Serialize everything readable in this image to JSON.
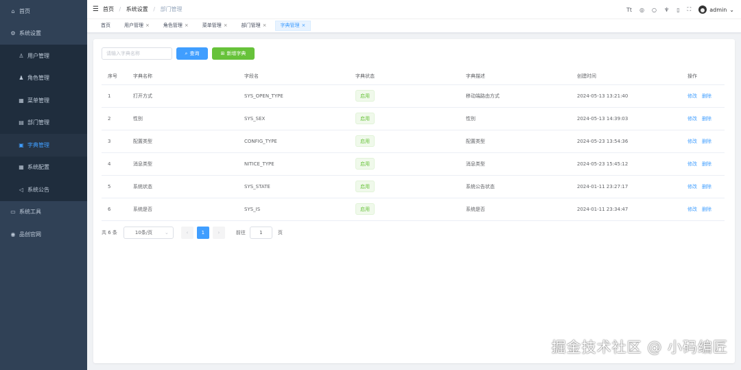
{
  "sidebar": {
    "items": [
      {
        "label": "首页",
        "icon": "home-icon",
        "glyph": "⌂",
        "level": 0,
        "active": false
      },
      {
        "label": "系统设置",
        "icon": "settings-icon",
        "glyph": "⚙",
        "level": 0,
        "active": false
      },
      {
        "label": "用户管理",
        "icon": "user-icon",
        "glyph": "♙",
        "level": 1,
        "active": false
      },
      {
        "label": "角色管理",
        "icon": "role-icon",
        "glyph": "♟",
        "level": 1,
        "active": false
      },
      {
        "label": "菜单管理",
        "icon": "menu-icon",
        "glyph": "▦",
        "level": 1,
        "active": false
      },
      {
        "label": "部门管理",
        "icon": "department-icon",
        "glyph": "▤",
        "level": 1,
        "active": false
      },
      {
        "label": "字典管理",
        "icon": "dictionary-icon",
        "glyph": "▣",
        "level": 1,
        "active": true
      },
      {
        "label": "系统配置",
        "icon": "config-icon",
        "glyph": "▦",
        "level": 1,
        "active": false
      },
      {
        "label": "系统公告",
        "icon": "announcement-icon",
        "glyph": "◁",
        "level": 1,
        "active": false
      },
      {
        "label": "系统工具",
        "icon": "tools-icon",
        "glyph": "▭",
        "level": 0,
        "active": false
      },
      {
        "label": "品创官网",
        "icon": "website-icon",
        "glyph": "◉",
        "level": 0,
        "active": false
      }
    ]
  },
  "header": {
    "breadcrumb": [
      "首页",
      "系统设置",
      "部门管理"
    ],
    "user": "admin"
  },
  "tabs": [
    {
      "label": "首页",
      "closable": false,
      "active": false
    },
    {
      "label": "用户管理",
      "closable": true,
      "active": false
    },
    {
      "label": "角色管理",
      "closable": true,
      "active": false
    },
    {
      "label": "菜单管理",
      "closable": true,
      "active": false
    },
    {
      "label": "部门管理",
      "closable": true,
      "active": false
    },
    {
      "label": "字典管理",
      "closable": true,
      "active": true
    }
  ],
  "search": {
    "placeholder": "请输入字典名称",
    "query_label": "查询",
    "add_label": "新增字典"
  },
  "table": {
    "columns": [
      "序号",
      "字典名称",
      "字段名",
      "字典状态",
      "字典描述",
      "创建时间",
      "操作"
    ],
    "edit_label": "修改",
    "delete_label": "删除",
    "rows": [
      {
        "index": "1",
        "name": "打开方式",
        "field": "SYS_OPEN_TYPE",
        "status": "启用",
        "desc": "移动端路由方式",
        "created": "2024-05-13 13:21:40"
      },
      {
        "index": "2",
        "name": "性别",
        "field": "SYS_SEX",
        "status": "启用",
        "desc": "性别",
        "created": "2024-05-13 14:39:03"
      },
      {
        "index": "3",
        "name": "配置类型",
        "field": "CONFIG_TYPE",
        "status": "启用",
        "desc": "配置类型",
        "created": "2024-05-23 13:54:36"
      },
      {
        "index": "4",
        "name": "消息类型",
        "field": "NITICE_TYPE",
        "status": "启用",
        "desc": "消息类型",
        "created": "2024-05-23 15:45:12"
      },
      {
        "index": "5",
        "name": "系统状态",
        "field": "SYS_STATE",
        "status": "启用",
        "desc": "系统公告状态",
        "created": "2024-01-11 23:27:17"
      },
      {
        "index": "6",
        "name": "系统是否",
        "field": "SYS_IS",
        "status": "启用",
        "desc": "系统是否",
        "created": "2024-01-11 23:34:47"
      }
    ]
  },
  "pagination": {
    "total": "共 6 条",
    "page_size": "10条/页",
    "current_page": "1",
    "goto_label": "前往",
    "goto_value": "1",
    "page_unit": "页"
  },
  "watermark": "掘金技术社区 @ 小码编匠"
}
